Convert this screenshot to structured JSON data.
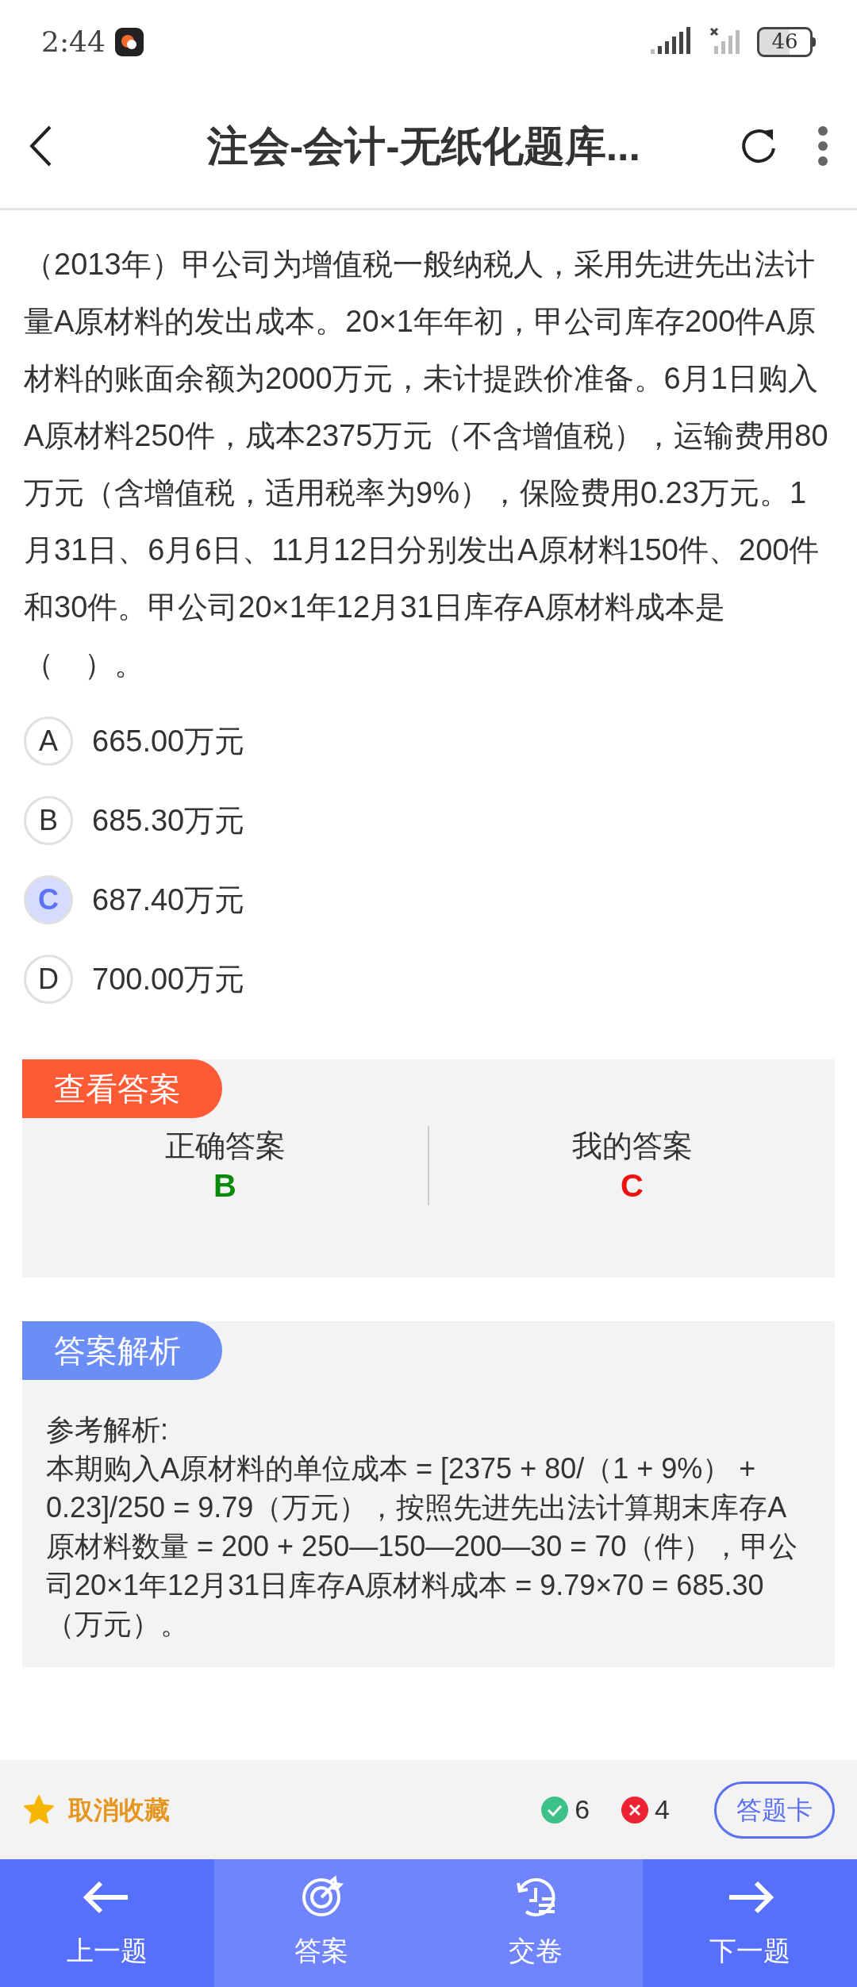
{
  "status_bar": {
    "time": "2:44",
    "battery": "46"
  },
  "header": {
    "title": "注会-会计-无纸化题库..."
  },
  "question": {
    "text": "（2013年）甲公司为增值税一般纳税人，采用先进先出法计量A原材料的发出成本。20×1年年初，甲公司库存200件A原材料的账面余额为2000万元，未计提跌价准备。6月1日购入A原材料250件，成本2375万元（不含增值税），运输费用80万元（含增值税，适用税率为9%），保险费用0.23万元。1月31日、6月6日、11月12日分别发出A原材料150件、200件和30件。甲公司20×1年12月31日库存A原材料成本是（　）。"
  },
  "options": [
    {
      "letter": "A",
      "text": "665.00万元",
      "selected": false
    },
    {
      "letter": "B",
      "text": "685.30万元",
      "selected": false
    },
    {
      "letter": "C",
      "text": "687.40万元",
      "selected": true
    },
    {
      "letter": "D",
      "text": "700.00万元",
      "selected": false
    }
  ],
  "answer_card": {
    "tag": "查看答案",
    "correct_label": "正确答案",
    "correct_answer": "B",
    "my_label": "我的答案",
    "my_answer": "C"
  },
  "analysis": {
    "tag": "答案解析",
    "heading": "参考解析:",
    "body": "本期购入A原材料的单位成本 = [2375 + 80/（1 + 9%） + 0.23]/250 = 9.79（万元），按照先进先出法计算期末库存A原材料数量 = 200 + 250—150—200—30 = 70（件），甲公司20×1年12月31日库存A原材料成本 = 9.79×70 = 685.30（万元）。"
  },
  "toolbar": {
    "favorite_label": "取消收藏",
    "correct_count": "6",
    "wrong_count": "4",
    "card_button": "答题卡"
  },
  "nav": [
    {
      "label": "上一题",
      "kind": "prev"
    },
    {
      "label": "答案",
      "kind": "answer"
    },
    {
      "label": "交卷",
      "kind": "submit"
    },
    {
      "label": "下一题",
      "kind": "next"
    }
  ]
}
